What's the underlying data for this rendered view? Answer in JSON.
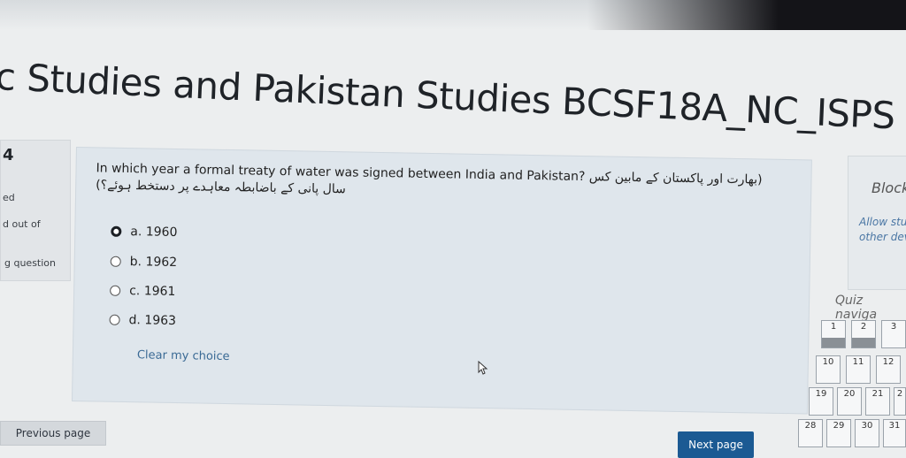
{
  "course_title": "c Studies and Pakistan Studies BCSF18A_NC_ISPS",
  "question_info": {
    "number": "4",
    "status": "ed",
    "marks": "d out of",
    "flag": "g question"
  },
  "question": {
    "text": "In which year a formal treaty of water was signed between India and Pakistan?",
    "urdu_line1": "(بھارت اور پاکستان کے مابین کس",
    "urdu_line2": "سال پانی کے باضابطہ معاہدے پر دستخط ہوئے؟)",
    "options": [
      {
        "label": "a. 1960",
        "selected": true
      },
      {
        "label": "b. 1962",
        "selected": false
      },
      {
        "label": "c. 1961",
        "selected": false
      },
      {
        "label": "d. 1963",
        "selected": false
      }
    ],
    "clear_label": "Clear my choice"
  },
  "buttons": {
    "previous": "Previous page",
    "next": "Next page"
  },
  "block": {
    "title": "Block",
    "desc_line1": "Allow stu",
    "desc_line2": "other dev"
  },
  "quiz_nav": {
    "title": "Quiz naviga",
    "rows": [
      [
        "1",
        "2",
        "3"
      ],
      [
        "10",
        "11",
        "12"
      ],
      [
        "19",
        "20",
        "21",
        "2"
      ],
      [
        "28",
        "29",
        "30",
        "31"
      ]
    ]
  },
  "colors": {
    "next_button": "#1b5a93",
    "link": "#3a6a95"
  }
}
